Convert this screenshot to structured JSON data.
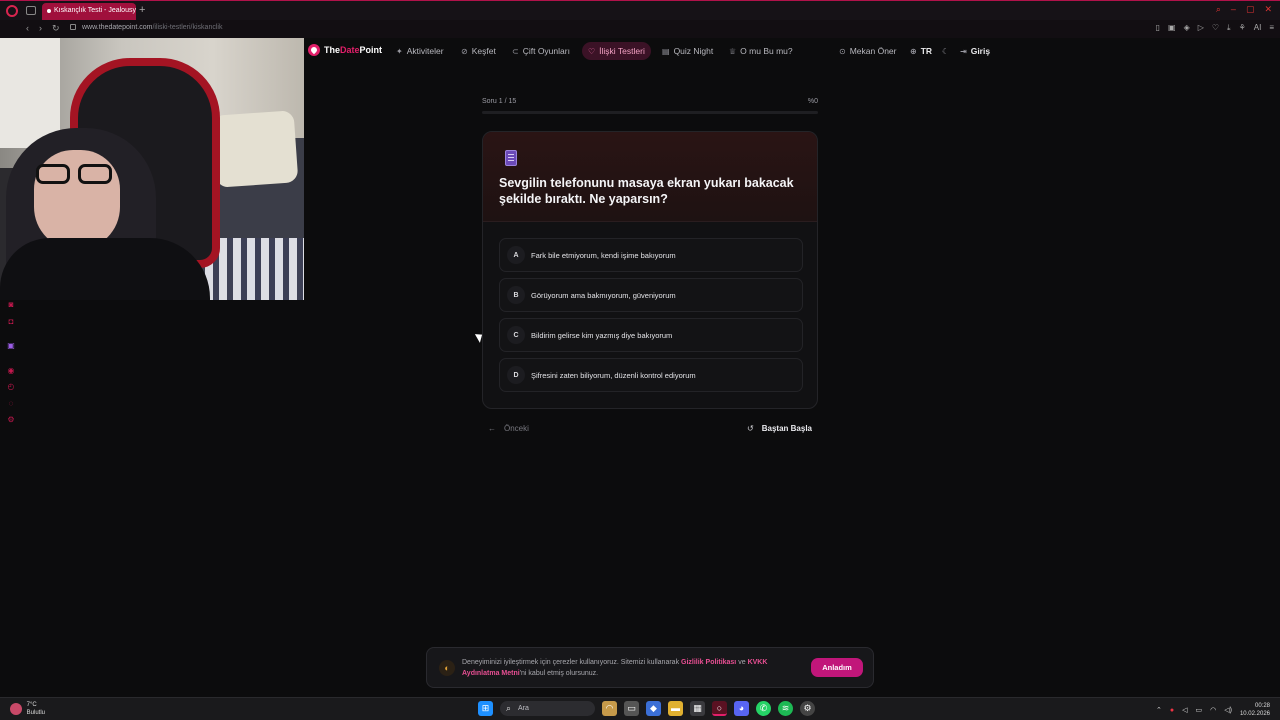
{
  "browser": {
    "tab_title": "Kıskançlık Testi - Jealousy",
    "new_tab": "+",
    "url_host": "www.thedatepoint.com",
    "url_path": "/iliski-testleri/kiskanclik",
    "ai_label": "AI"
  },
  "site": {
    "brand_first": "The",
    "brand_second": "Date",
    "brand_third": "Point",
    "accent_color": "#e21f6a",
    "nav": {
      "activities": "Aktiviteler",
      "explore": "Keşfet",
      "couple_games": "Çift Oyunları",
      "relationship_tests": "İlişki Testleri",
      "quiz_night": "Quiz Night",
      "who_is_it": "O mu Bu mu?",
      "suggest_place": "Mekan Öner",
      "language": "TR",
      "login": "Giriş"
    }
  },
  "quiz": {
    "progress_label": "Soru 1 / 15",
    "progress_percent_label": "%0",
    "progress_fraction": 0,
    "question": "Sevgilin telefonunu masaya ekran yukarı bakacak şekilde bıraktı. Ne yaparsın?",
    "options": [
      {
        "letter": "A",
        "text": "Fark bile etmiyorum, kendi işime bakıyorum"
      },
      {
        "letter": "B",
        "text": "Görüyorum ama bakmıyorum, güveniyorum"
      },
      {
        "letter": "C",
        "text": "Bildirim gelirse kim yazmış diye bakıyorum"
      },
      {
        "letter": "D",
        "text": "Şifresini zaten biliyorum, düzenli kontrol ediyorum"
      }
    ],
    "prev_label": "Önceki",
    "restart_label": "Baştan Başla"
  },
  "cookie": {
    "text_before": "Deneyiminizi iyileştirmek için çerezler kullanıyoruz. Sitemizi kullanarak ",
    "privacy_link": "Gizlilik Politikası",
    "and": " ve ",
    "kvkk_link": "KVKK Aydınlatma Metni",
    "text_after": "'ni kabul etmiş olursunuz.",
    "accept_label": "Anladım"
  },
  "taskbar": {
    "temperature": "7°C",
    "weather": "Bulutlu",
    "search_placeholder": "Ara",
    "time": "00:28",
    "date": "10.02.2026"
  }
}
